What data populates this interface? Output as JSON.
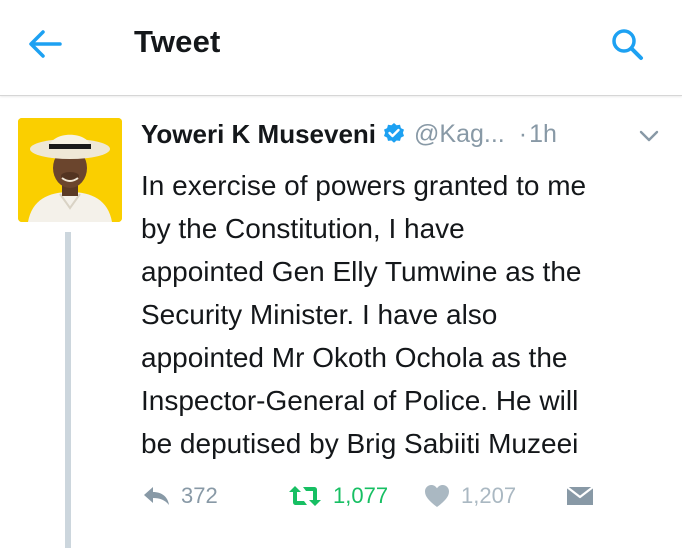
{
  "header": {
    "title": "Tweet",
    "back_icon": "back-arrow-icon",
    "search_icon": "search-icon"
  },
  "tweet": {
    "author_name": "Yoweri K Museveni",
    "verified": true,
    "handle": "@Kag...",
    "separator": "·",
    "time": "1h",
    "body_lines": [
      "In exercise of powers granted to me",
      "by the Constitution, I have",
      "appointed Gen Elly Tumwine as the",
      "Security Minister. I have also",
      "appointed Mr Okoth Ochola as the",
      "Inspector-General of Police. He will",
      "be deputised by Brig Sabiiti Muzeei"
    ],
    "stats": {
      "replies": "372",
      "retweets": "1,077",
      "likes": "1,207"
    }
  },
  "colors": {
    "accent": "#1da1f2",
    "retweet_active": "#17bf63",
    "muted": "#8899a6",
    "text": "#14171a",
    "avatar_bg": "#ffd400"
  }
}
